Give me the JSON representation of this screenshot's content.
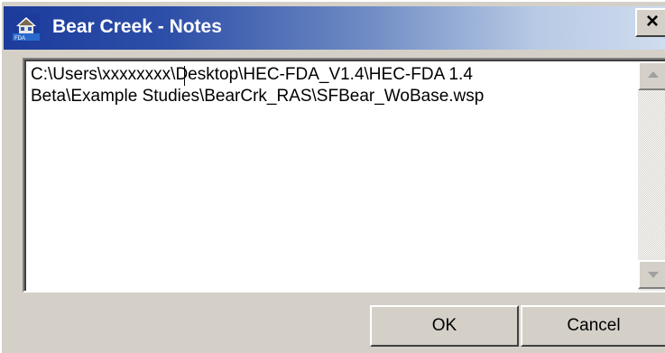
{
  "window": {
    "title": "Bear Creek - Notes",
    "close_label": "×"
  },
  "icons": {
    "app": "hec-fda-app-icon",
    "close": "close-icon",
    "scroll_up": "scroll-up-arrow-icon",
    "scroll_down": "scroll-down-arrow-icon"
  },
  "notes": {
    "text": "C:\\Users\\xxxxxxxx\\Desktop\\HEC-FDA_V1.4\\HEC-FDA 1.4\nBeta\\Example Studies\\BearCrk_RAS\\SFBear_WoBase.wsp"
  },
  "buttons": {
    "ok_label": "OK",
    "cancel_label": "Cancel"
  },
  "colors": {
    "titlebar_start": "#1c3b9c",
    "titlebar_end": "#d0dcef",
    "dialog_face": "#d4d0c8"
  }
}
